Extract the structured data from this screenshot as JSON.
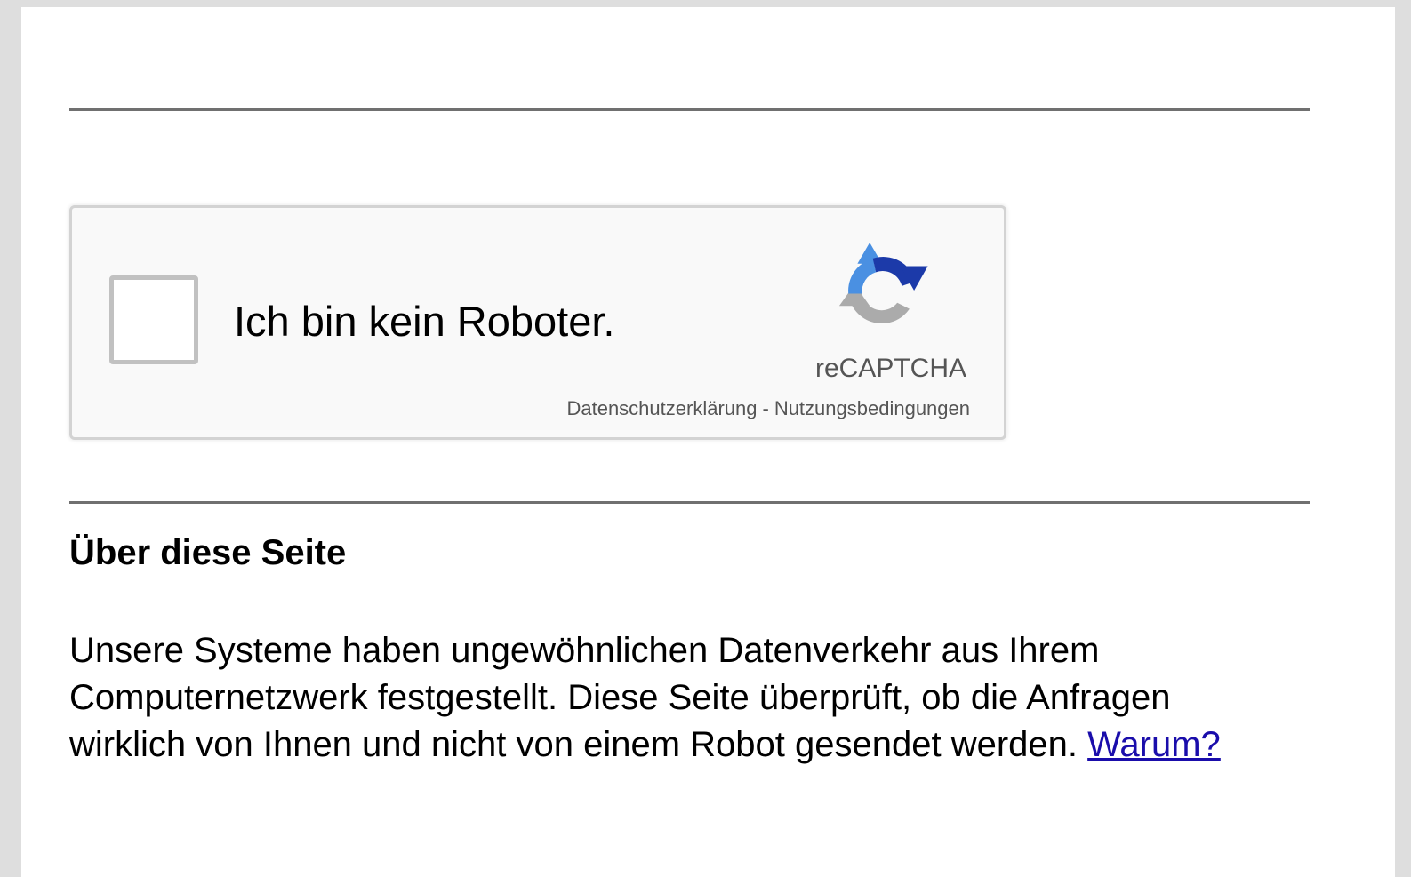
{
  "recaptcha": {
    "checkbox_label": "Ich bin kein Roboter.",
    "brand": "reCAPTCHA",
    "privacy_link": "Datenschutzerklärung",
    "separator": "-",
    "terms_link": "Nutzungsbedingungen",
    "logo_icon": "recaptcha-logo-icon",
    "colors": {
      "logo_blue_dark": "#1c3aa9",
      "logo_blue_light": "#4a90e2",
      "logo_grey": "#ababab",
      "box_bg": "#f9f9f9",
      "box_border": "#d3d3d3"
    }
  },
  "about": {
    "title": "Über diese Seite",
    "body": "Unsere Systeme haben ungewöhnlichen Datenverkehr aus Ihrem Computernetzwerk festgestellt. Diese Seite überprüft, ob die Anfragen wirklich von Ihnen und nicht von einem Robot gesendet werden.",
    "why_link": "Warum?",
    "link_color": "#1a0dab"
  }
}
